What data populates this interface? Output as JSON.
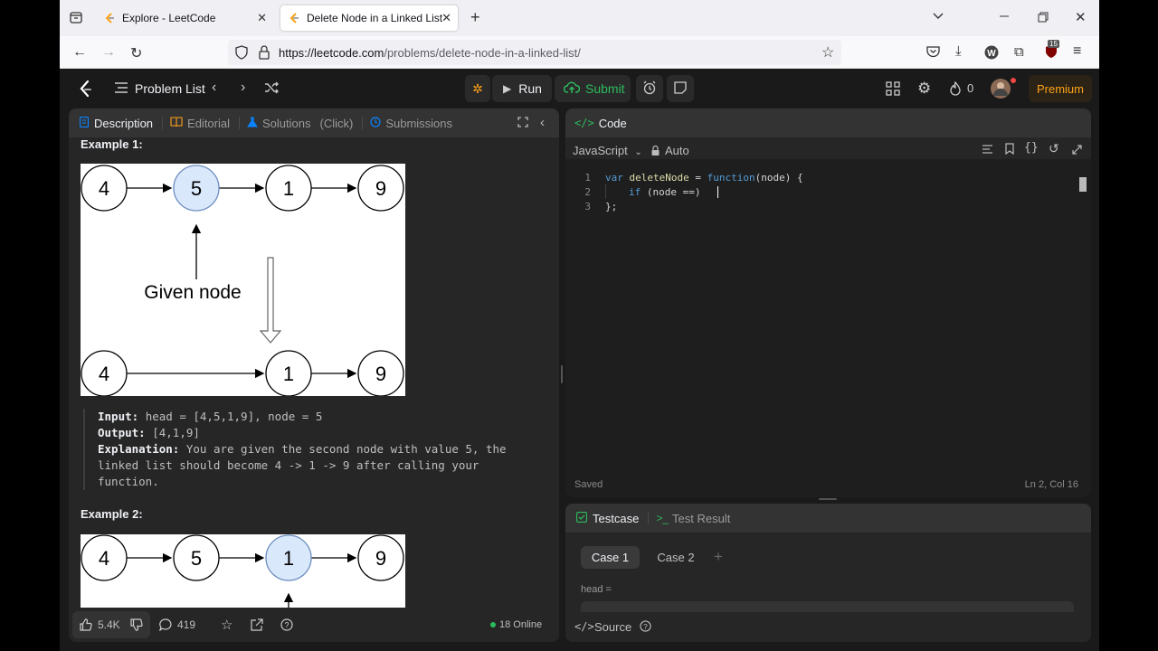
{
  "browser": {
    "tabs": [
      {
        "title": "Explore - LeetCode"
      },
      {
        "title": "Delete Node in a Linked List - L"
      }
    ],
    "url_host": "https://leetcode.com",
    "url_path": "/problems/delete-node-in-a-linked-list/",
    "extension_badge": "15"
  },
  "header": {
    "problem_list": "Problem List",
    "run": "Run",
    "submit": "Submit",
    "streak": "0",
    "premium": "Premium"
  },
  "description": {
    "tabs": [
      {
        "label": "Description"
      },
      {
        "label": "Editorial"
      },
      {
        "label": "Solutions"
      },
      {
        "label": "(Click)"
      },
      {
        "label": "Submissions"
      }
    ],
    "example1_title": "Example 1:",
    "example2_title": "Example 2:",
    "diagram1": {
      "top_nodes": [
        "4",
        "5",
        "1",
        "9"
      ],
      "bottom_nodes": [
        "4",
        "1",
        "9"
      ],
      "caption": "Given node"
    },
    "diagram2": {
      "nodes": [
        "4",
        "5",
        "1",
        "9"
      ]
    },
    "example1": {
      "input_label": "Input:",
      "input_value": "head = [4,5,1,9], node = 5",
      "output_label": "Output:",
      "output_value": "[4,1,9]",
      "explanation_label": "Explanation:",
      "explanation_line1": "You are given the second node with value 5, the",
      "explanation_line2": "linked list should become 4 -> 1 -> 9 after calling your",
      "explanation_line3": "function."
    },
    "footer": {
      "likes": "5.4K",
      "comments": "419",
      "online": "18 Online"
    }
  },
  "code_panel": {
    "title": "Code",
    "language": "JavaScript",
    "mode": "Auto",
    "lines": [
      {
        "n": "1"
      },
      {
        "n": "2"
      },
      {
        "n": "3"
      }
    ],
    "code": {
      "l1_kw": "var",
      "l1_name": "deleteNode",
      "l1_eq": " = ",
      "l1_fn": "function",
      "l1_rest": "(node) {",
      "l2_kw": "if",
      "l2_rest": " (node ==)",
      "l3": "};"
    },
    "status_left": "Saved",
    "status_right": "Ln 2, Col 16"
  },
  "test_panel": {
    "tab_testcase": "Testcase",
    "tab_result": "Test Result",
    "cases": [
      "Case 1",
      "Case 2"
    ],
    "field_label": "head =",
    "source": "Source"
  }
}
